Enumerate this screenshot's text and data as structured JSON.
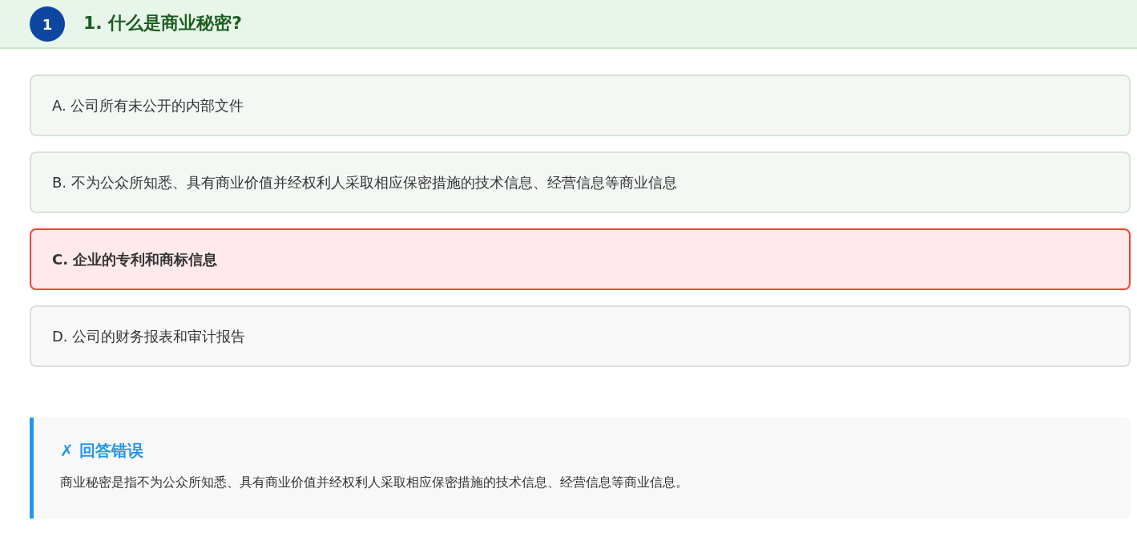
{
  "question": {
    "number": "1",
    "title": "1. 什么是商业秘密?"
  },
  "options": [
    {
      "label": "A. 公司所有未公开的内部文件",
      "kind": "tinted",
      "selected": false
    },
    {
      "label": "B. 不为公众所知悉、具有商业价值并经权利人采取相应保密措施的技术信息、经营信息等商业信息",
      "kind": "tinted",
      "selected": false
    },
    {
      "label": "C. 企业的专利和商标信息",
      "kind": "plain",
      "selected": true
    },
    {
      "label": "D. 公司的财务报表和审计报告",
      "kind": "plain",
      "selected": false
    }
  ],
  "feedback": {
    "title": "✗ 回答错误",
    "text": "商业秘密是指不为公众所知悉、具有商业价值并经权利人采取相应保密措施的技术信息、经营信息等商业信息。"
  }
}
